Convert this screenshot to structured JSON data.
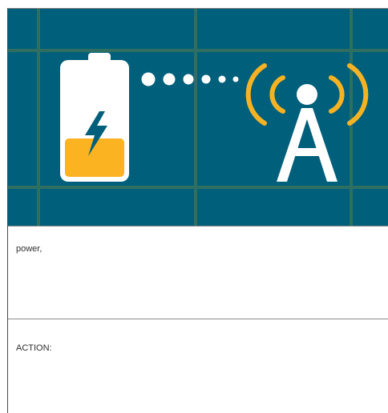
{
  "illustration": {
    "subject": "battery-to-cell-tower",
    "colors": {
      "background": "#005f7a",
      "grid": "#2f6f62",
      "battery_fill": "#fbb321",
      "signal_waves": "#f5b324",
      "white": "#ffffff"
    },
    "battery_charge_fraction": 0.35,
    "icons": [
      "battery-icon",
      "lightning-bolt-icon",
      "dotted-signal-icon",
      "cell-tower-icon",
      "radio-waves-icon"
    ]
  },
  "sections": [
    {
      "text": "power,"
    },
    {
      "text": "ACTION:"
    }
  ]
}
